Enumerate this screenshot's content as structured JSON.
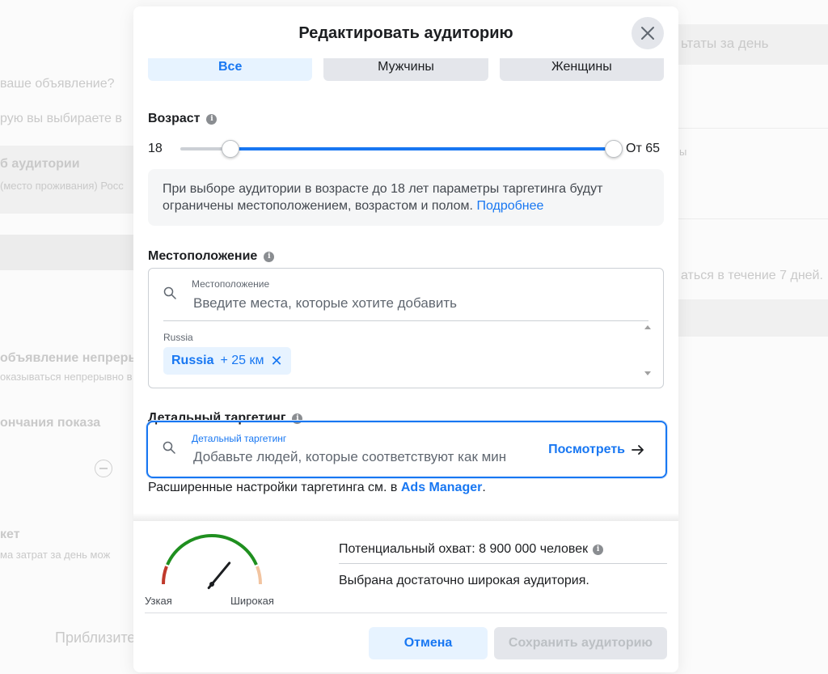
{
  "background": {
    "right_title": "ьтаты за день",
    "right_hint": "аться в течение 7 дней.",
    "left_q1": "ваше объявление?",
    "left_q2": "рую вы выбираете в",
    "left_audience": "б аудитории",
    "left_audience_sub": "(место проживания) Росс",
    "left_continuous": "объявление непреры",
    "left_continuous_sub": "оказываться непрерывно в",
    "left_end": "ончания показа",
    "left_budget": "кет",
    "left_budget_sub": "ма затрат за день мож",
    "left_approx": "Приблизите"
  },
  "modal": {
    "title": "Редактировать аудиторию"
  },
  "gender": {
    "options": [
      "Все",
      "Мужчины",
      "Женщины"
    ],
    "selected": "Все"
  },
  "age": {
    "label": "Возраст",
    "min_label": "18",
    "max_label": "От 65",
    "min": 18,
    "max": 65
  },
  "notice": {
    "text": "При выборе аудитории в возрасте до 18 лет параметры таргетинга будут ограничены местоположением, возрастом и полом.",
    "link": "Подробнее"
  },
  "location": {
    "label": "Местоположение",
    "field_caption": "Местоположение",
    "placeholder": "Введите места, которые хотите добавить",
    "country": "Russia",
    "chip_name": "Russia",
    "chip_radius": "+ 25 км"
  },
  "detailed": {
    "label": "Детальный таргетинг",
    "field_caption": "Детальный таргетинг",
    "placeholder": "Добавьте людей, которые соответствуют как мин",
    "browse": "Посмотреть",
    "advanced_text": "Расширенные настройки таргетинга см. в",
    "advanced_link": "Ads Manager"
  },
  "reach": {
    "narrow": "Узкая",
    "wide": "Широкая",
    "potential": "Потенциальный охват: 8 900 000 человек",
    "description": "Выбрана достаточно широкая аудитория.",
    "gauge_level": 0.72
  },
  "footer": {
    "cancel": "Отмена",
    "save": "Сохранить аудиторию"
  },
  "colors": {
    "accent": "#1877f2",
    "gauge_green": "#1f8f1f",
    "gauge_red": "#c0392b",
    "gauge_peach": "#f2c4a0"
  }
}
